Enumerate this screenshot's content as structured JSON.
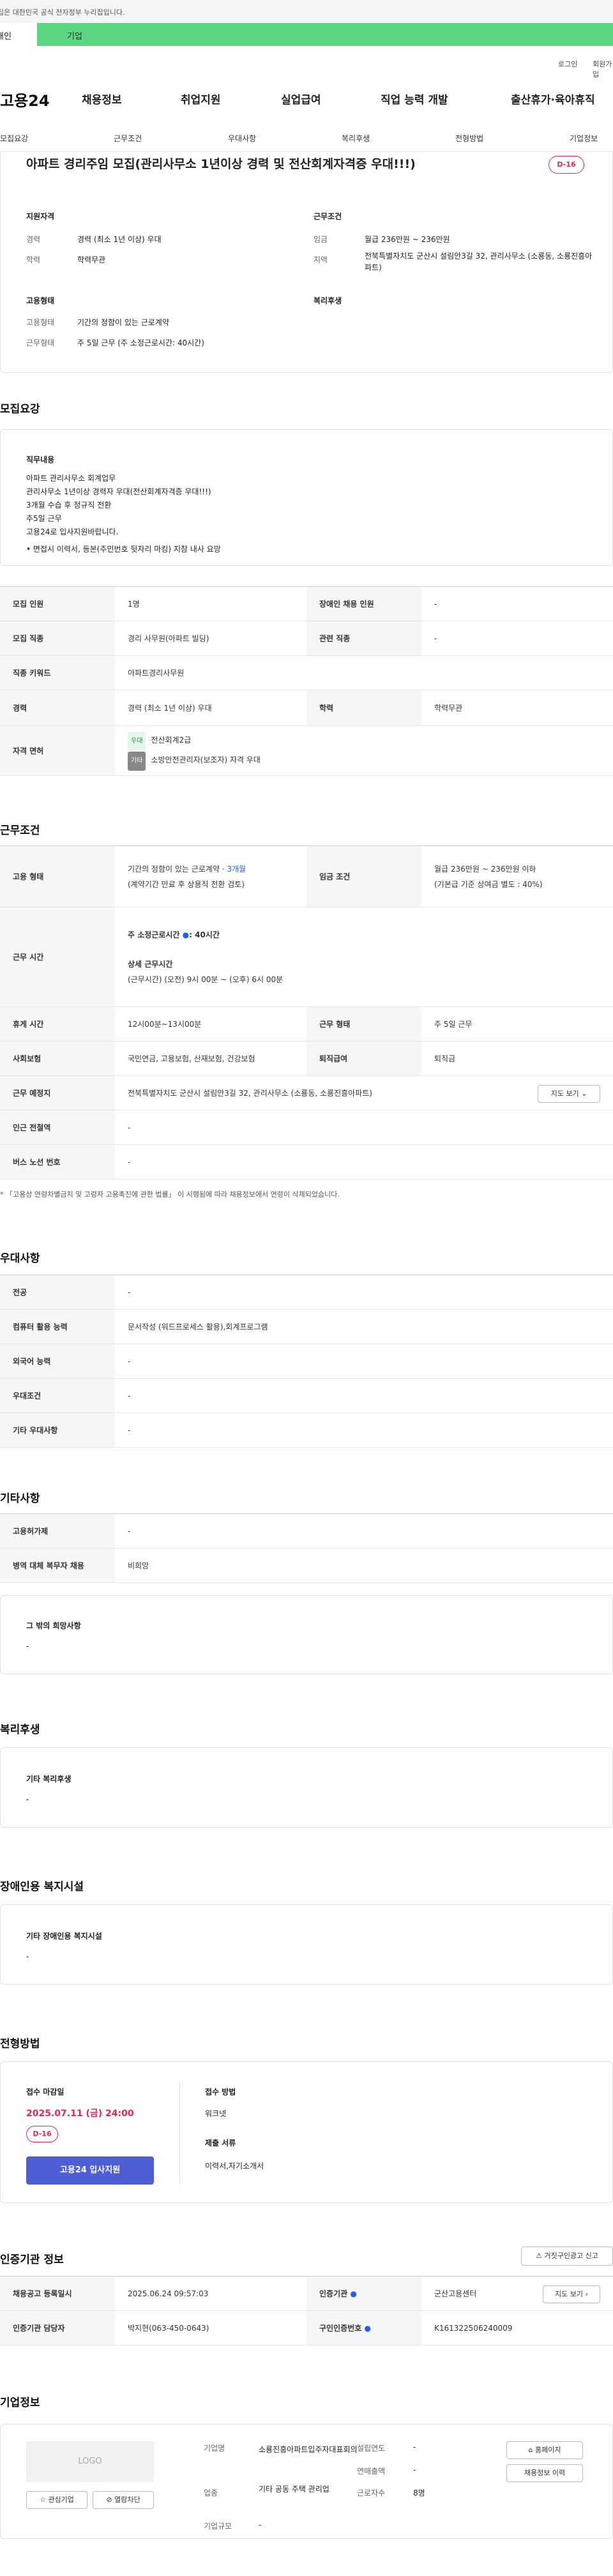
{
  "gov_banner": "이 누리집은 대한민국 공식 전자정부 누리집입니다.",
  "tabs": {
    "individual": "개인",
    "enterprise": "기업"
  },
  "utils": {
    "login": "로그인",
    "join": "회원가입"
  },
  "logo": "고용24",
  "gnb": [
    "채용정보",
    "취업지원",
    "실업급여",
    "직업 능력 개발",
    "출산휴가·육아휴직"
  ],
  "subnav": [
    "모집요강",
    "근무조건",
    "우대사항",
    "복리후생",
    "전형방법",
    "기업정보"
  ],
  "job": {
    "title": "아파트 경리주임 모집(관리사무소 1년이상 경력 및 전산회계자격증 우대!!!)",
    "dday": "D-16",
    "summary": {
      "qual_title": "지원자격",
      "career_label": "경력",
      "career_value": "경력 (최소 1년 이상) 우대",
      "edu_label": "학력",
      "edu_value": "학력무관",
      "work_title": "근무조건",
      "wage_label": "임금",
      "wage_value": "월급 236만원 ~ 236만원",
      "region_label": "지역",
      "region_value": "전북특별자치도 군산시 설림안3길 32, 관리사무소 (소룡동, 소룡진흥아파트)",
      "emp_title": "고용형태",
      "emptype_label": "고용형태",
      "emptype_value": "기간의 정함이 있는 근로계약",
      "worktype_label": "근무형태",
      "worktype_value": "주 5일 근무 (주 소정근로시간: 40시간)",
      "welfare_title": "복리후생"
    }
  },
  "recruit": {
    "title": "모집요강",
    "duty_title": "직무내용",
    "duty_lines": [
      "아파트 관리사무소 회계업무",
      "관리사무소 1년이상 경력자 우대(전산회계자격증 우대!!!)",
      "3개월 수습 후 정규직 전환",
      "주5일 근무",
      "고용24로 입사지원바랍니다."
    ],
    "duty_note": "• 면접시 이력서, 등본(주민번호 뒷자리 마킹) 지참 내사 요망",
    "rows": [
      {
        "k": "모집 인원",
        "v": "1명",
        "k2": "장애인 채용 인원",
        "v2": "-"
      },
      {
        "k": "모집 직종",
        "v": "경리 사무원(아파트 빌딩)",
        "k2": "관련 직종",
        "v2": "-"
      },
      {
        "k": "직종 키워드",
        "v": "아파트경리사무원"
      },
      {
        "k": "경력",
        "v": "경력 (최소 1년 이상) 우대",
        "k2": "학력",
        "v2": "학력무관"
      }
    ],
    "license_label": "자격 면허",
    "licenses": [
      {
        "badge": "우대",
        "name": "전산회계2급"
      },
      {
        "badge": "기타",
        "name": "소방안전관리자(보조자) 자격 우대"
      }
    ]
  },
  "conditions": {
    "title": "근무조건",
    "emptype_label": "고용 형태",
    "emptype_line1": "기간의 정함이 있는 근로계약 · ",
    "emptype_months": "3개월",
    "emptype_line2": "(계약기간 만료 후 상용직 전환 검토)",
    "wage_label": "임금 조건",
    "wage_line1": "월급 236만원 ~ 236만원 이하",
    "wage_line2": "(기본급 기준 상여금 별도 : 40%)",
    "hours_label": "근무 시간",
    "hours_week": "주 소정근로시간 ",
    "hours_week_val": ": 40시간",
    "hours_detail_title": "상세 근무시간",
    "hours_detail": "(근무시간) (오전) 9시 00분 ~ (오후) 6시 00분",
    "rows": [
      {
        "k": "휴게 시간",
        "v": "12시00분~13시00분",
        "k2": "근무 형태",
        "v2": "주 5일 근무"
      },
      {
        "k": "사회보험",
        "v": "국민연금, 고용보험, 산재보험, 건강보험",
        "k2": "퇴직급여",
        "v2": "퇴직금"
      },
      {
        "k": "근무 예정지",
        "v": "전북특별자치도 군산시 설림안3길 32, 관리사무소 (소룡동, 소룡진흥아파트)"
      },
      {
        "k": "인근 전철역",
        "v": "-"
      },
      {
        "k": "버스 노선 번호",
        "v": "-"
      }
    ],
    "map_btn": "지도 보기",
    "note": "* 「고용상 연령차별금지 및 고령자 고용촉진에 관한 법률」 이 시행됨에 따라 채용정보에서 연령이 삭제되었습니다."
  },
  "preferences": {
    "title": "우대사항",
    "rows": [
      {
        "k": "전공",
        "v": "-"
      },
      {
        "k": "컴퓨터 활용 능력",
        "v": "문서작성 (워드프로세스 활용),회계프로그램"
      },
      {
        "k": "외국어 능력",
        "v": "-"
      },
      {
        "k": "우대조건",
        "v": "-"
      },
      {
        "k": "기타 우대사항",
        "v": "-"
      }
    ]
  },
  "etc": {
    "title": "기타사항",
    "rows": [
      {
        "k": "고용허가제",
        "v": "-"
      },
      {
        "k": "병역 대체 복무자 채용",
        "v": "비희망"
      }
    ],
    "other_title": "그 밖의 희망사항",
    "other_value": "-"
  },
  "welfare": {
    "title": "복리후생",
    "box_title": "기타 복리후생",
    "box_value": "-"
  },
  "disability": {
    "title": "장애인용 복지시설",
    "box_title": "기타 장애인용 복지시설",
    "box_value": "-"
  },
  "selection": {
    "title": "전형방법",
    "deadline_title": "접수 마감일",
    "deadline": "2025.07.11 (금) 24:00",
    "dday": "D-16",
    "apply_btn": "고용24 입사지원",
    "method_title": "접수 방법",
    "method_value": "워크넷",
    "docs_title": "제출 서류",
    "docs_value": "이력서,자기소개서"
  },
  "agency": {
    "title": "인증기관 정보",
    "report_btn": "거짓구인광고 신고",
    "rows": [
      {
        "k": "채용공고 등록일시",
        "v": "2025.06.24 09:57:03",
        "k2": "인증기관",
        "v2": "군산고용센터"
      },
      {
        "k": "인증기관 담당자",
        "v": "박지현(063-450-0643)",
        "k2": "구인인증번호",
        "v2": "K161322506240009"
      }
    ],
    "map_btn": "지도 보기"
  },
  "company": {
    "title": "기업정보",
    "logo_text": "LOGO",
    "fav_btn": "관심기업",
    "block_btn": "열람차단",
    "name_label": "기업명",
    "name_value": "소룡진흥아파트입주자대표회의",
    "industry_label": "업종",
    "industry_value": "기타 공동 주택 관리업",
    "scale_label": "기업규모",
    "scale_value": "-",
    "founded_label": "설립연도",
    "founded_value": "-",
    "sales_label": "연매출액",
    "sales_value": "-",
    "employees_label": "근로자수",
    "employees_value": "8명",
    "home_btn": "홈페이지",
    "list_btn": "채용정보 이력"
  }
}
